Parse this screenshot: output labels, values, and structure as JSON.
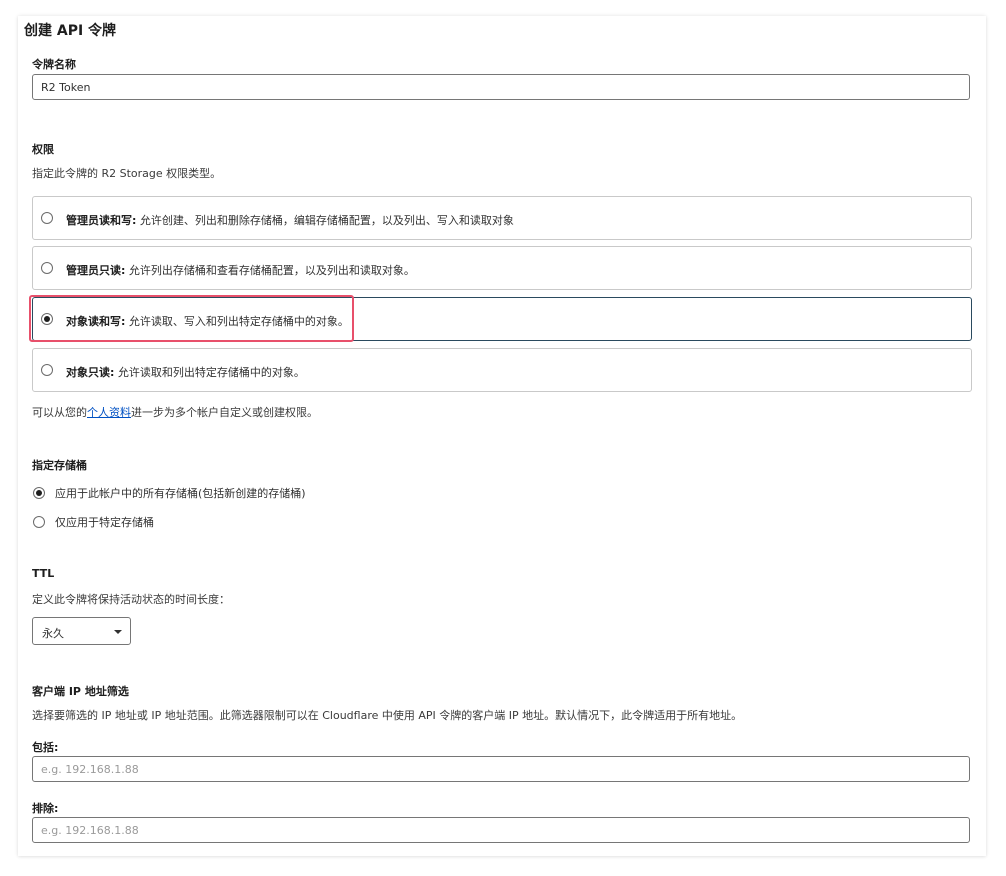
{
  "page": {
    "title": "创建 API 令牌"
  },
  "token_name": {
    "label": "令牌名称",
    "value": "R2 Token"
  },
  "permissions": {
    "label": "权限",
    "description": "指定此令牌的 R2 Storage 权限类型。",
    "options": [
      {
        "name": "管理员读和写:",
        "desc": " 允许创建、列出和删除存储桶，编辑存储桶配置，以及列出、写入和读取对象",
        "selected": false
      },
      {
        "name": "管理员只读:",
        "desc": " 允许列出存储桶和查看存储桶配置，以及列出和读取对象。",
        "selected": false
      },
      {
        "name": "对象读和写:",
        "desc": " 允许读取、写入和列出特定存储桶中的对象。",
        "selected": true
      },
      {
        "name": "对象只读:",
        "desc": " 允许读取和列出特定存储桶中的对象。",
        "selected": false
      }
    ],
    "footer_prefix": "可以从您的",
    "footer_link": "个人资料",
    "footer_suffix": "进一步为多个帐户自定义或创建权限。"
  },
  "buckets": {
    "label": "指定存储桶",
    "options": [
      {
        "label": "应用于此帐户中的所有存储桶(包括新创建的存储桶)",
        "selected": true
      },
      {
        "label": "仅应用于特定存储桶",
        "selected": false
      }
    ]
  },
  "ttl": {
    "label": "TTL",
    "description": "定义此令牌将保持活动状态的时间长度：",
    "value": "永久"
  },
  "ip_filter": {
    "label": "客户端 IP 地址筛选",
    "description": "选择要筛选的 IP 地址或 IP 地址范围。此筛选器限制可以在 Cloudflare 中使用 API 令牌的客户端 IP 地址。默认情况下，此令牌适用于所有地址。",
    "include_label": "包括:",
    "include_placeholder": "e.g. 192.168.1.88",
    "exclude_label": "排除:",
    "exclude_placeholder": "e.g. 192.168.1.88"
  },
  "colors": {
    "highlight": "#e8506b",
    "selected_border": "#2a4a5e",
    "link": "#0051c3"
  }
}
